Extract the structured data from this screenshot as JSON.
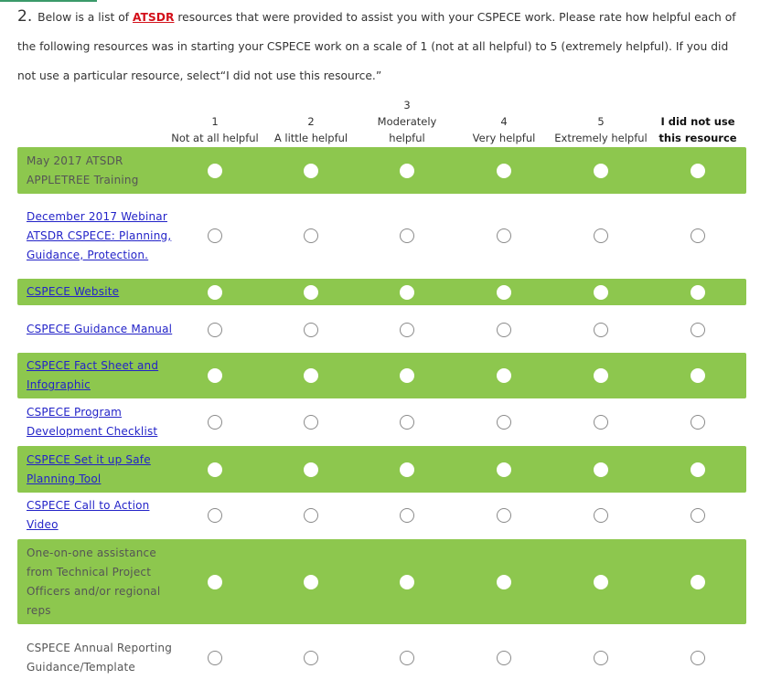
{
  "question": {
    "number": "2.",
    "text_before": "Below is a list of ",
    "link_text": "ATSDR",
    "text_after": " resources that were provided to assist you with your CSPECE work. Please rate how helpful each of the following resources was in starting your CSPECE work on a scale of 1 (not at all helpful) to 5 (extremely helpful). If you did not use a particular resource, select“I did not use this resource.”"
  },
  "columns": [
    {
      "num": "1",
      "label": "Not at all helpful",
      "bold": false
    },
    {
      "num": "2",
      "label": "A little helpful",
      "bold": false
    },
    {
      "num": "3",
      "label": "Moderately helpful",
      "bold": false
    },
    {
      "num": "4",
      "label": "Very helpful",
      "bold": false
    },
    {
      "num": "5",
      "label": "Extremely helpful",
      "bold": false
    },
    {
      "num": "",
      "label": "I did not use this resource",
      "bold": true
    }
  ],
  "rows": [
    {
      "label": "May 2017 ATSDR APPLETREE Training",
      "link": false
    },
    {
      "label": "December 2017 Webinar ATSDR CSPECE: Planning, Guidance, Protection.",
      "link": true
    },
    {
      "label": "CSPECE Website",
      "link": true
    },
    {
      "label": "CSPECE Guidance Manual",
      "link": true
    },
    {
      "label": "CSPECE Fact Sheet and Infographic",
      "link": true
    },
    {
      "label": "CSPECE Program Development Checklist",
      "link": true
    },
    {
      "label": "CSPECE Set it up Safe Planning Tool",
      "link": true
    },
    {
      "label": "CSPECE Call to Action Video",
      "link": true
    },
    {
      "label": "One-on-one assistance from Technical Project Officers and/or regional reps",
      "link": false
    },
    {
      "label": "CSPECE Annual Reporting Guidance/Template",
      "link": false
    }
  ],
  "colors": {
    "green_row": "#8dc74e",
    "link": "#2323c8",
    "question_link": "#d3101a"
  }
}
